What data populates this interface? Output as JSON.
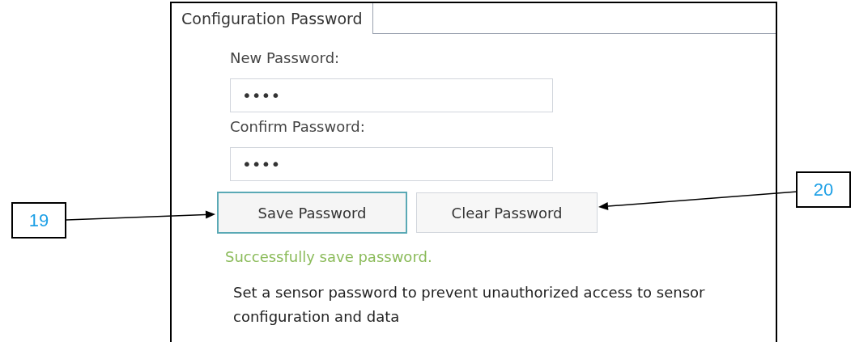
{
  "tabs": [
    {
      "label": "Configuration Password",
      "selected": true
    }
  ],
  "fields": [
    {
      "label": "New Password:",
      "value": "••••"
    },
    {
      "label": "Confirm Password:",
      "value": "••••"
    }
  ],
  "buttons": [
    {
      "label": "Save Password",
      "focused": true
    },
    {
      "label": "Clear Password",
      "focused": false
    }
  ],
  "status_message": "Successfully save password.",
  "description": "Set a sensor password to prevent unauthorized access to sensor configuration and data",
  "callouts": [
    {
      "label": "19"
    },
    {
      "label": "20"
    }
  ]
}
